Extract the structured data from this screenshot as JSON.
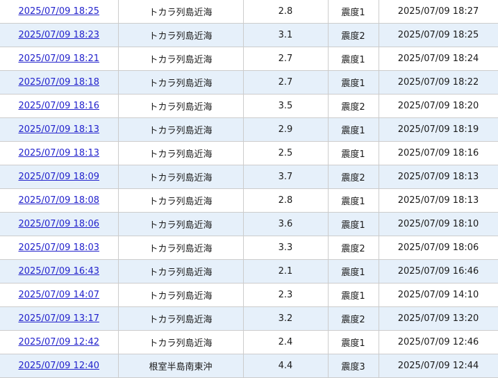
{
  "rows": [
    {
      "time": "2025/07/09 18:25",
      "region": "トカラ列島近海",
      "magnitude": "2.8",
      "intensity": "震度1",
      "issued": "2025/07/09 18:27"
    },
    {
      "time": "2025/07/09 18:23",
      "region": "トカラ列島近海",
      "magnitude": "3.1",
      "intensity": "震度2",
      "issued": "2025/07/09 18:25"
    },
    {
      "time": "2025/07/09 18:21",
      "region": "トカラ列島近海",
      "magnitude": "2.7",
      "intensity": "震度1",
      "issued": "2025/07/09 18:24"
    },
    {
      "time": "2025/07/09 18:18",
      "region": "トカラ列島近海",
      "magnitude": "2.7",
      "intensity": "震度1",
      "issued": "2025/07/09 18:22"
    },
    {
      "time": "2025/07/09 18:16",
      "region": "トカラ列島近海",
      "magnitude": "3.5",
      "intensity": "震度2",
      "issued": "2025/07/09 18:20"
    },
    {
      "time": "2025/07/09 18:13",
      "region": "トカラ列島近海",
      "magnitude": "2.9",
      "intensity": "震度1",
      "issued": "2025/07/09 18:19"
    },
    {
      "time": "2025/07/09 18:13",
      "region": "トカラ列島近海",
      "magnitude": "2.5",
      "intensity": "震度1",
      "issued": "2025/07/09 18:16"
    },
    {
      "time": "2025/07/09 18:09",
      "region": "トカラ列島近海",
      "magnitude": "3.7",
      "intensity": "震度2",
      "issued": "2025/07/09 18:13"
    },
    {
      "time": "2025/07/09 18:08",
      "region": "トカラ列島近海",
      "magnitude": "2.8",
      "intensity": "震度1",
      "issued": "2025/07/09 18:13"
    },
    {
      "time": "2025/07/09 18:06",
      "region": "トカラ列島近海",
      "magnitude": "3.6",
      "intensity": "震度1",
      "issued": "2025/07/09 18:10"
    },
    {
      "time": "2025/07/09 18:03",
      "region": "トカラ列島近海",
      "magnitude": "3.3",
      "intensity": "震度2",
      "issued": "2025/07/09 18:06"
    },
    {
      "time": "2025/07/09 16:43",
      "region": "トカラ列島近海",
      "magnitude": "2.1",
      "intensity": "震度1",
      "issued": "2025/07/09 16:46"
    },
    {
      "time": "2025/07/09 14:07",
      "region": "トカラ列島近海",
      "magnitude": "2.3",
      "intensity": "震度1",
      "issued": "2025/07/09 14:10"
    },
    {
      "time": "2025/07/09 13:17",
      "region": "トカラ列島近海",
      "magnitude": "3.2",
      "intensity": "震度2",
      "issued": "2025/07/09 13:20"
    },
    {
      "time": "2025/07/09 12:42",
      "region": "トカラ列島近海",
      "magnitude": "2.4",
      "intensity": "震度1",
      "issued": "2025/07/09 12:46"
    },
    {
      "time": "2025/07/09 12:40",
      "region": "根室半島南東沖",
      "magnitude": "4.4",
      "intensity": "震度3",
      "issued": "2025/07/09 12:44"
    }
  ],
  "colors": {
    "link": "#2222cc",
    "row_stripe": "#e6f0fa",
    "border": "#cccccc"
  }
}
